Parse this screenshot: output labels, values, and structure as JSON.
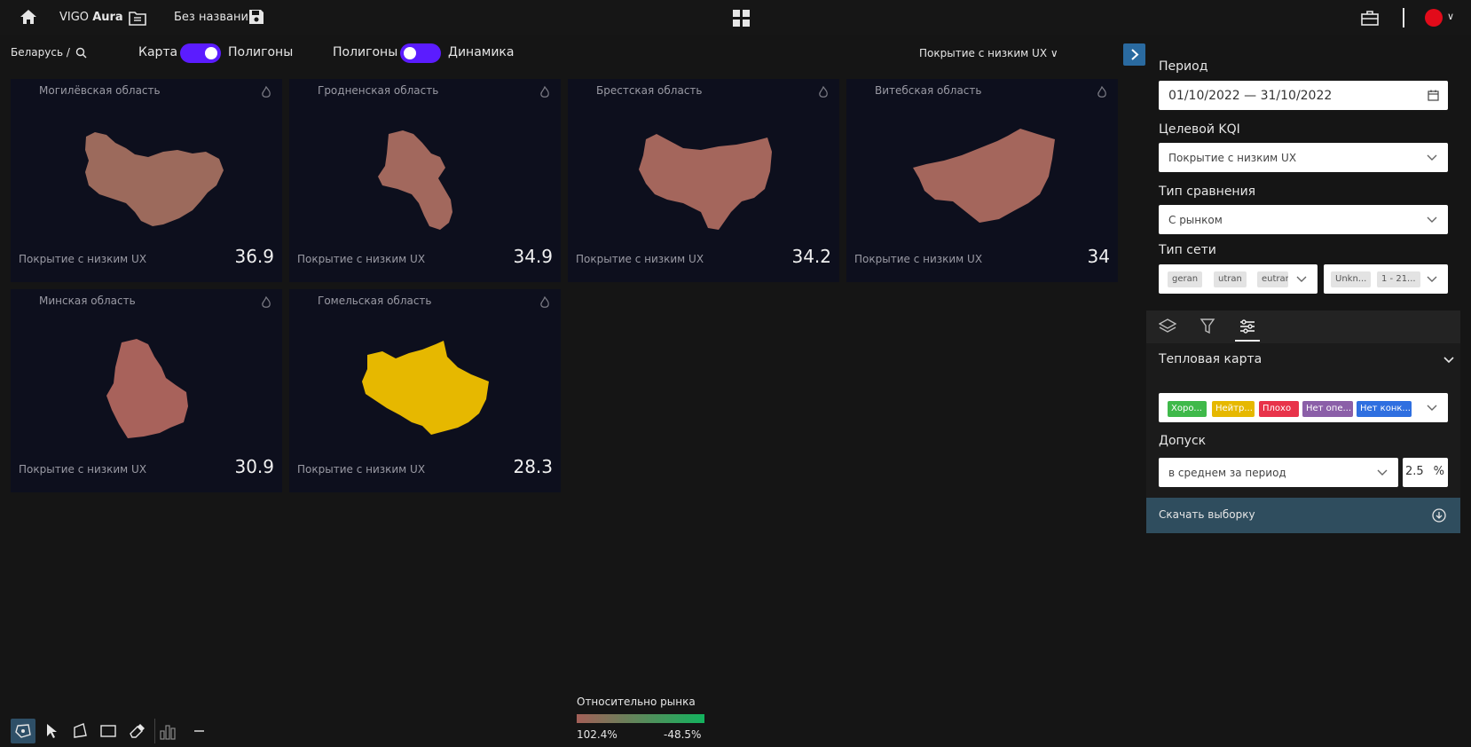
{
  "header": {
    "app_name_prefix": "VIGO",
    "app_name_suffix": "Aura",
    "document_title": "Без названия"
  },
  "controls": {
    "breadcrumb": "Беларусь  /",
    "toggle1_left": "Карта",
    "toggle1_right": "Полигоны",
    "toggle2_left": "Полигоны",
    "toggle2_right": "Динамика",
    "kqi_selector": "Покрытие с низким UX ∨"
  },
  "cards": [
    {
      "region": "Могилёвская область",
      "metric_label": "Покрытие с низким UX",
      "value": "36.9",
      "fill": "#9c6a5c"
    },
    {
      "region": "Гродненская область",
      "metric_label": "Покрытие с низким UX",
      "value": "34.9",
      "fill": "#a2685d"
    },
    {
      "region": "Брестская область",
      "metric_label": "Покрытие с низким UX",
      "value": "34.2",
      "fill": "#a4665c"
    },
    {
      "region": "Витебская область",
      "metric_label": "Покрытие с низким UX",
      "value": "34",
      "fill": "#a4665c"
    },
    {
      "region": "Минская область",
      "metric_label": "Покрытие с низким UX",
      "value": "30.9",
      "fill": "#a8625b"
    },
    {
      "region": "Гомельская область",
      "metric_label": "Покрытие с низким UX",
      "value": "28.3",
      "fill": "#e6b800"
    }
  ],
  "panel": {
    "period_label": "Период",
    "period_value": "01/10/2022 — 31/10/2022",
    "kqi_label": "Целевой KQI",
    "kqi_value": "Покрытие с низким UX",
    "comparison_label": "Тип сравнения",
    "comparison_value": "С рынком",
    "network_label": "Тип сети",
    "network_chips": [
      "geran",
      "utran",
      "eutran"
    ],
    "network2_chips": [
      "Unkn...",
      "1 - 21..."
    ],
    "heatmap_title": "Тепловая карта",
    "heatmap_chips": [
      {
        "label": "Хоро...",
        "color": "#3fb94a"
      },
      {
        "label": "Нейтр...",
        "color": "#e6b800"
      },
      {
        "label": "Плохо",
        "color": "#e8334a"
      },
      {
        "label": "Нет опе...",
        "color": "#8b5fa8"
      },
      {
        "label": "Нет конк...",
        "color": "#2f6fe0"
      }
    ],
    "tolerance_label": "Допуск",
    "tolerance_mode": "в среднем за период",
    "tolerance_value": "2.5",
    "tolerance_unit": "%",
    "download_label": "Скачать выборку"
  },
  "legend": {
    "title": "Относительно рынка",
    "min_label": "102.4%",
    "max_label": "-48.5%",
    "color_from": "#a35f58",
    "color_to": "#13b35e"
  },
  "icons": [
    "home-icon",
    "folder-icon",
    "save-icon",
    "grid-icon",
    "toolbox-icon",
    "search-icon",
    "chevron-right-icon",
    "calendar-icon",
    "chevron-down-icon",
    "layers-icon",
    "filter-icon",
    "sliders-icon",
    "download-icon",
    "fire-icon",
    "polygon-select-icon",
    "pointer-icon",
    "polygon-icon",
    "rectangle-icon",
    "eraser-icon",
    "bar-chart-icon",
    "minus-icon"
  ]
}
